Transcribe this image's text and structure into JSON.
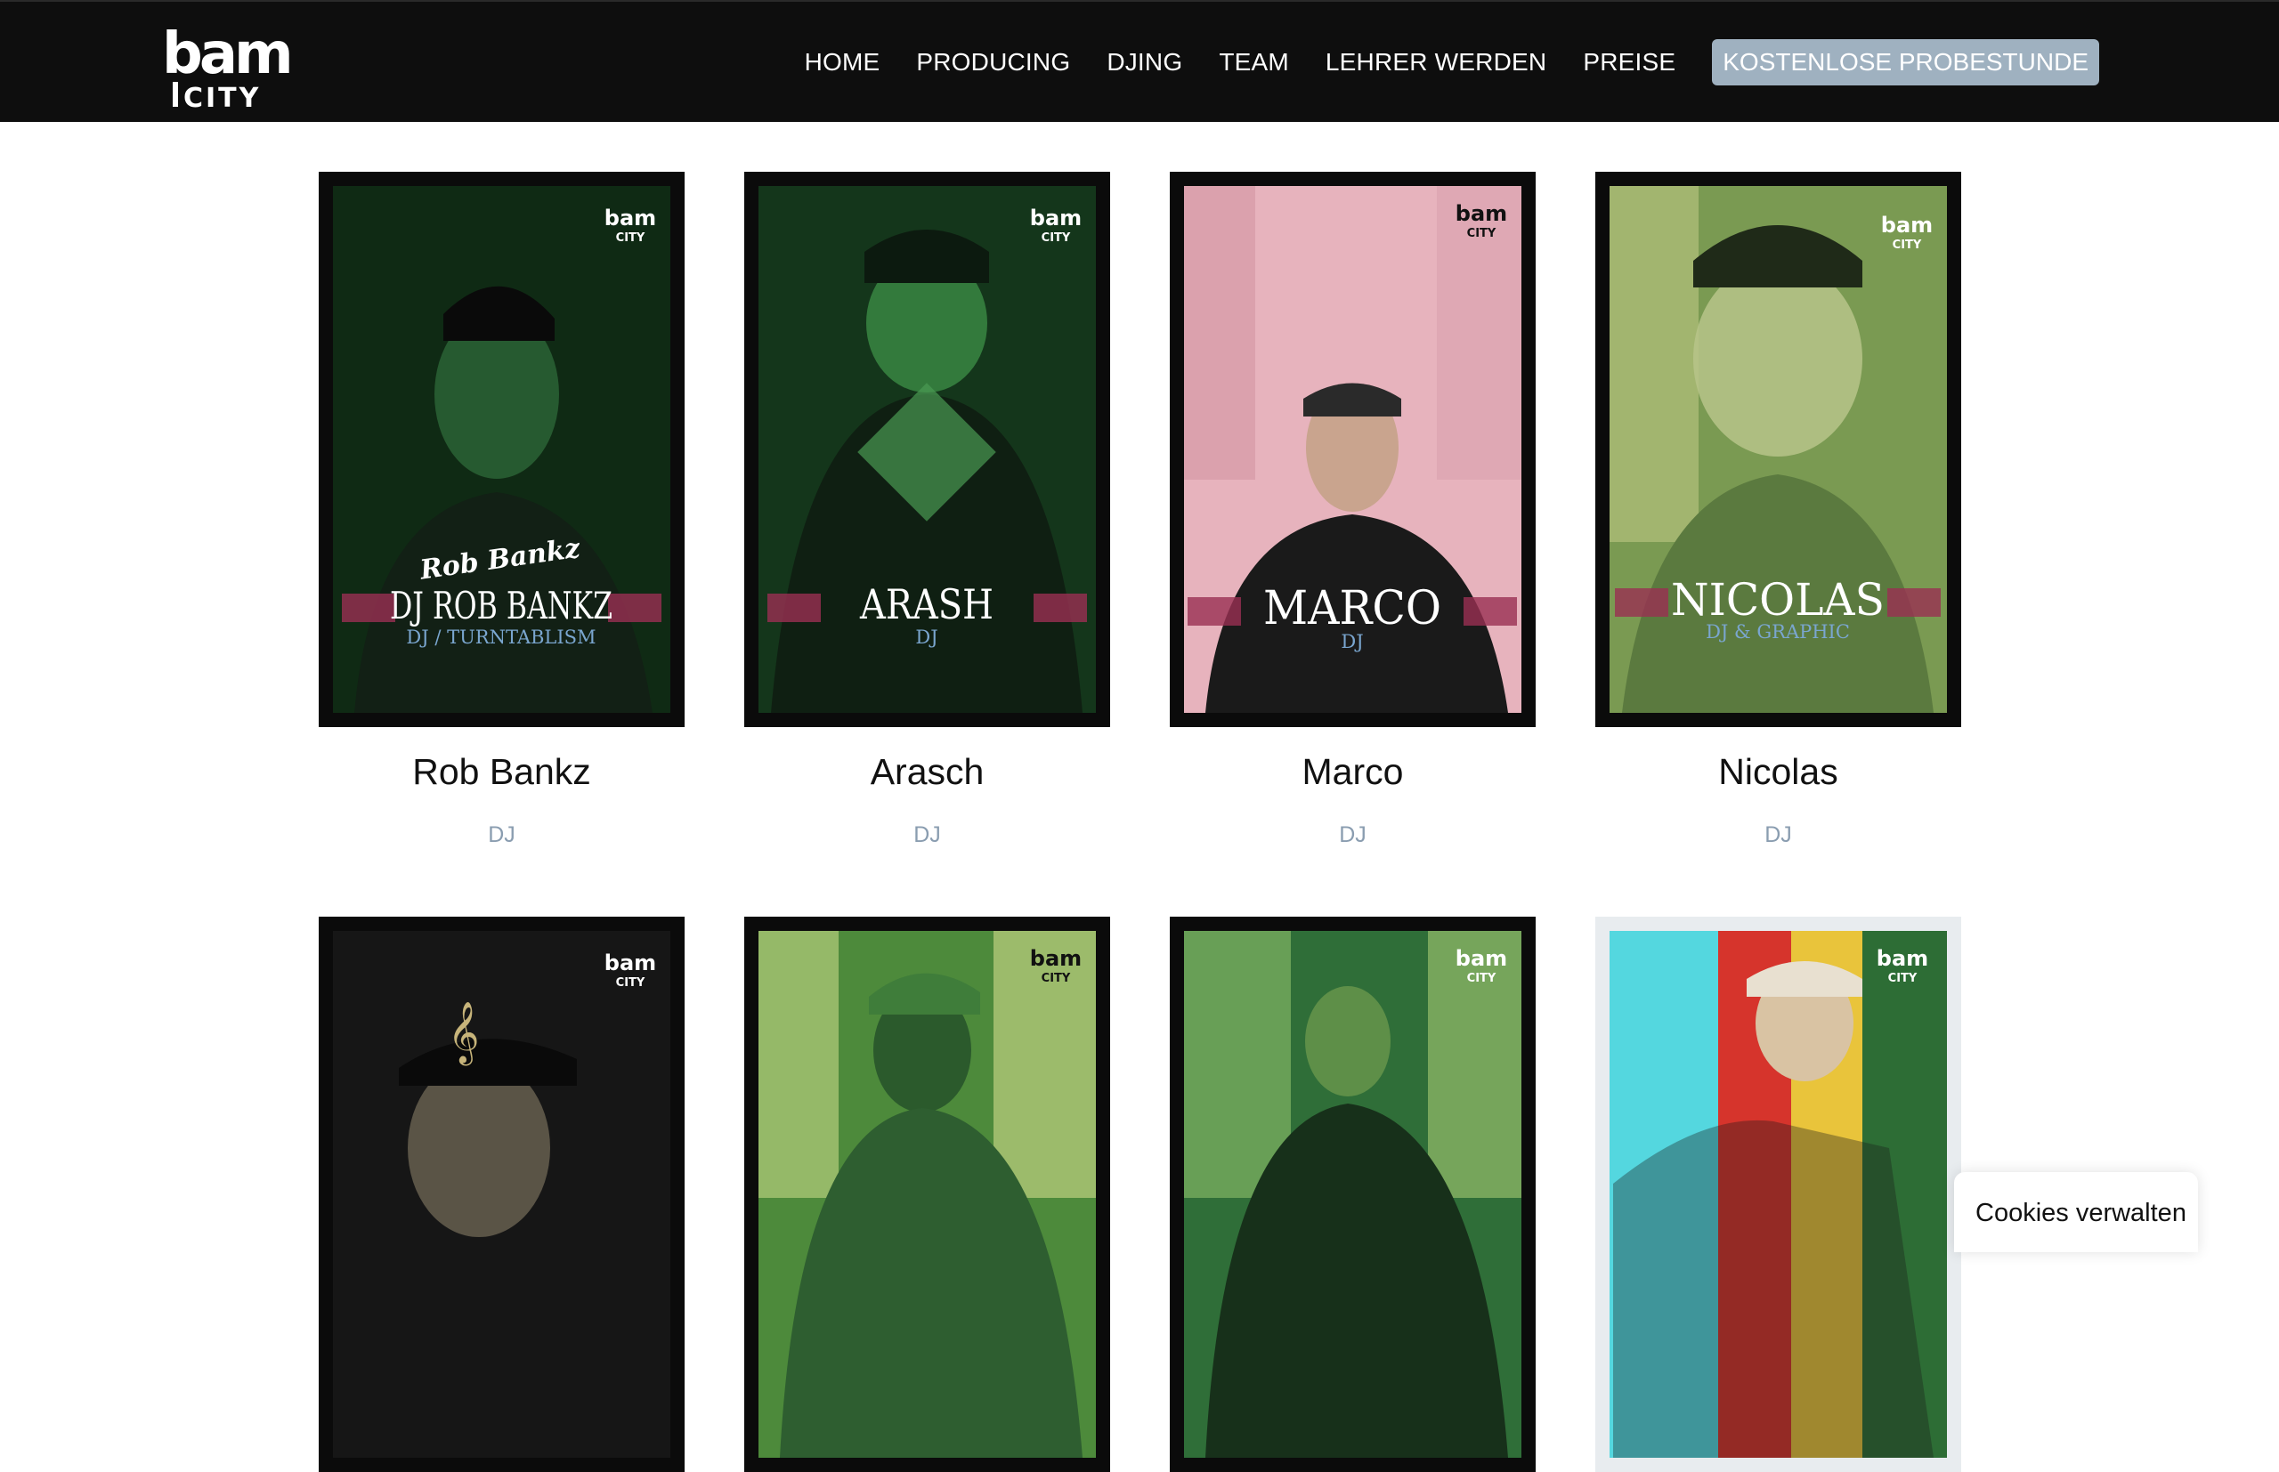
{
  "nav": {
    "items": [
      "HOME",
      "PRODUCING",
      "DJING",
      "TEAM",
      "LEHRER WERDEN",
      "PREISE"
    ],
    "cta": "KOSTENLOSE PROBESTUNDE"
  },
  "team": [
    {
      "name": "Rob Bankz",
      "role": "DJ",
      "poster_title": "DJ ROB BANKZ",
      "poster_subtitle": "DJ / TURNTABLISM",
      "poster_logo": "Rob Bankz",
      "colors": {
        "bg": "#0f2a14",
        "accent": "#2f6b3a"
      }
    },
    {
      "name": "Arasch",
      "role": "DJ",
      "poster_title": "ARASH",
      "poster_subtitle": "DJ",
      "colors": {
        "bg": "#14361b",
        "accent": "#3b8c45"
      }
    },
    {
      "name": "Marco",
      "role": "DJ",
      "poster_title": "MARCO",
      "poster_subtitle": "DJ",
      "colors": {
        "bg": "#e7b3bd",
        "accent": "#1a1a1a"
      }
    },
    {
      "name": "Nicolas",
      "role": "DJ",
      "poster_title": "NICOLAS",
      "poster_subtitle": "DJ & GRAPHIC",
      "colors": {
        "bg": "#7a9a52",
        "accent": "#c9cf8c"
      }
    }
  ],
  "team_row2": [
    {
      "colors": {
        "bg": "#161616",
        "accent": "#5a5446"
      }
    },
    {
      "colors": {
        "bg": "#4d8a3b",
        "accent": "#c7d887"
      }
    },
    {
      "colors": {
        "bg": "#2f6e38",
        "accent": "#8fbf6a"
      }
    },
    {
      "colors": {
        "stripes": [
          "#54d7df",
          "#d6342c",
          "#e9c43b",
          "#2d6d35"
        ]
      }
    }
  ],
  "cookie": {
    "label": "Cookies verwalten"
  }
}
